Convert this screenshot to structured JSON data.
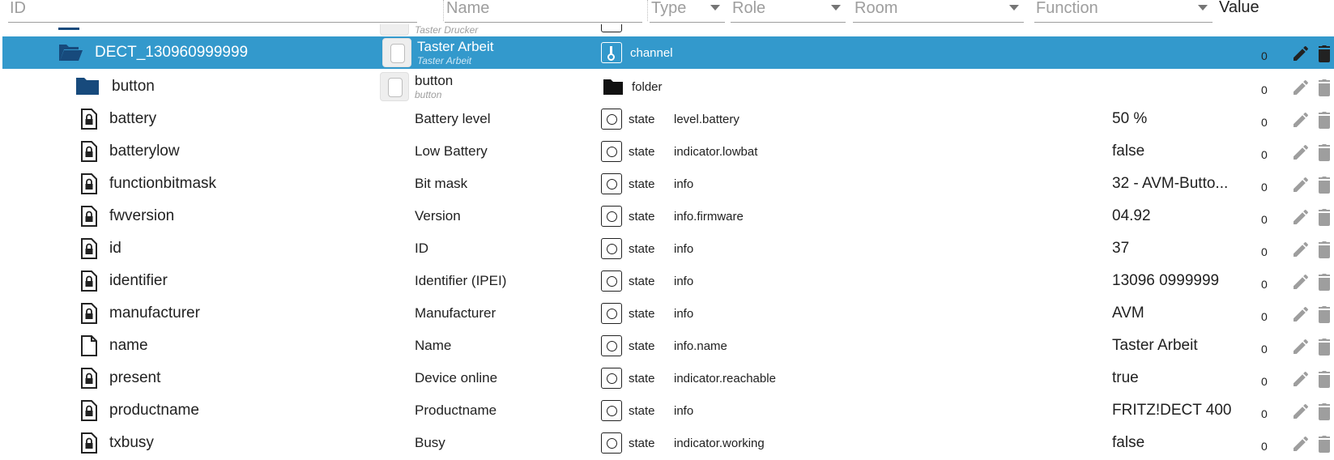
{
  "header": {
    "id_placeholder": "ID",
    "name_placeholder": "Name",
    "type_label": "Type",
    "role_label": "Role",
    "room_label": "Room",
    "function_label": "Function",
    "value_label": "Value"
  },
  "partial_row": {
    "name_sub": "Taster Drucker"
  },
  "channel_row": {
    "id": "DECT_130960999999",
    "name": "Taster Arbeit",
    "name_sub": "Taster Arbeit",
    "type": "channel",
    "count": "0"
  },
  "folder_row": {
    "id": "button",
    "name": "button",
    "name_sub": "button",
    "type": "folder",
    "count": "0"
  },
  "states": [
    {
      "id": "battery",
      "name": "Battery level",
      "type": "state",
      "role": "level.battery",
      "value": "50 %",
      "count": "0",
      "locked": true
    },
    {
      "id": "batterylow",
      "name": "Low Battery",
      "type": "state",
      "role": "indicator.lowbat",
      "value": "false",
      "count": "0",
      "locked": true
    },
    {
      "id": "functionbitmask",
      "name": "Bit mask",
      "type": "state",
      "role": "info",
      "value": "32 - AVM-Butto...",
      "count": "0",
      "locked": true
    },
    {
      "id": "fwversion",
      "name": "Version",
      "type": "state",
      "role": "info.firmware",
      "value": "04.92",
      "count": "0",
      "locked": true
    },
    {
      "id": "id",
      "name": "ID",
      "type": "state",
      "role": "info",
      "value": "37",
      "count": "0",
      "locked": true
    },
    {
      "id": "identifier",
      "name": "Identifier (IPEI)",
      "type": "state",
      "role": "info",
      "value": "13096 0999999",
      "count": "0",
      "locked": true
    },
    {
      "id": "manufacturer",
      "name": "Manufacturer",
      "type": "state",
      "role": "info",
      "value": "AVM",
      "count": "0",
      "locked": true
    },
    {
      "id": "name",
      "name": "Name",
      "type": "state",
      "role": "info.name",
      "value": "Taster Arbeit",
      "count": "0",
      "locked": false
    },
    {
      "id": "present",
      "name": "Device online",
      "type": "state",
      "role": "indicator.reachable",
      "value": "true",
      "count": "0",
      "locked": true
    },
    {
      "id": "productname",
      "name": "Productname",
      "type": "state",
      "role": "info",
      "value": "FRITZ!DECT 400",
      "count": "0",
      "locked": true
    },
    {
      "id": "txbusy",
      "name": "Busy",
      "type": "state",
      "role": "indicator.working",
      "value": "false",
      "count": "0",
      "locked": true
    }
  ],
  "colors": {
    "selected_row": "#3399cc",
    "folder_icon": "#174a7c",
    "action_icon": "#9e9e9e"
  }
}
